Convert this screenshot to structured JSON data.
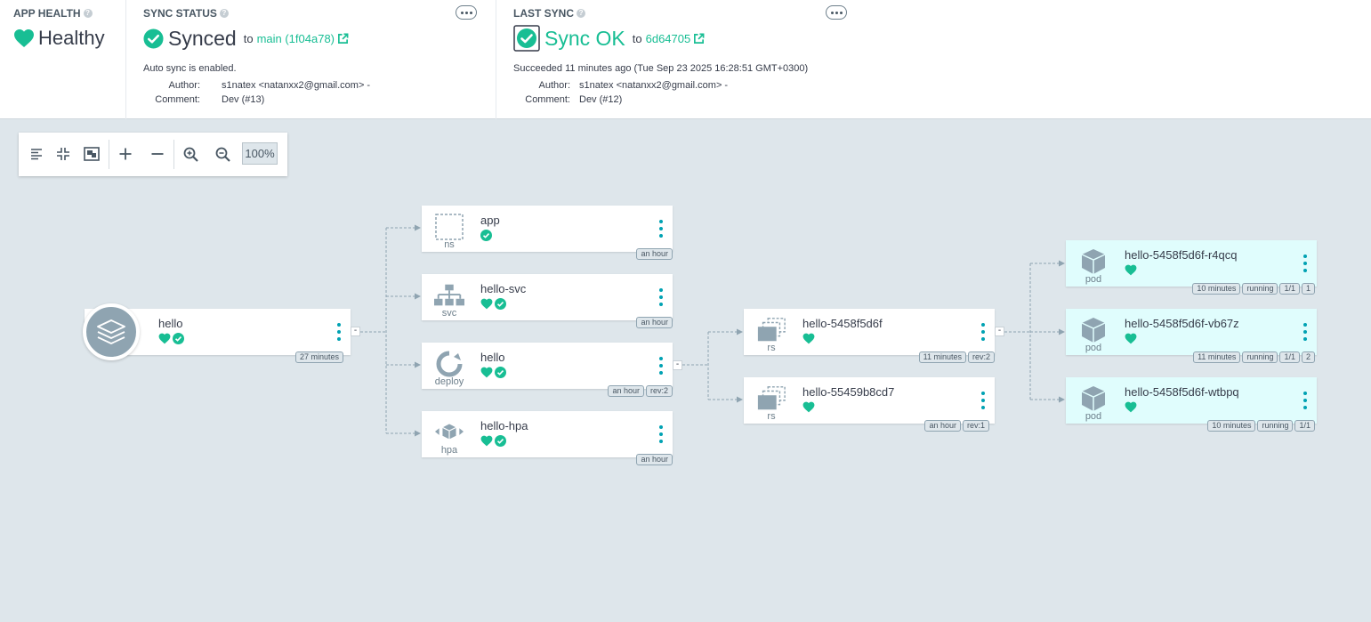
{
  "app_health": {
    "title": "APP HEALTH",
    "status": "Healthy",
    "color": "#18be94"
  },
  "sync_status": {
    "title": "SYNC STATUS",
    "status": "Synced",
    "to": "to",
    "revision": "main (1f04a78)",
    "auto_sync": "Auto sync is enabled.",
    "author_label": "Author:",
    "author": "s1natex <natanxx2@gmail.com> -",
    "comment_label": "Comment:",
    "comment": "Dev (#13)"
  },
  "last_sync": {
    "title": "LAST SYNC",
    "status": "Sync OK",
    "to": "to",
    "revision": "6d64705",
    "succeeded": "Succeeded 11 minutes ago (Tue Sep 23 2025 16:28:51 GMT+0300)",
    "author_label": "Author:",
    "author": "s1natex <natanxx2@gmail.com> -",
    "comment_label": "Comment:",
    "comment": "Dev (#12)"
  },
  "toolbar": {
    "zoom": "100%"
  },
  "graph": {
    "app": {
      "name": "hello",
      "tags": [
        "27 minutes"
      ],
      "collapse": "-"
    },
    "ns": {
      "kind": "ns",
      "name": "app",
      "tags": [
        "an hour"
      ]
    },
    "svc": {
      "kind": "svc",
      "name": "hello-svc",
      "tags": [
        "an hour"
      ]
    },
    "deploy": {
      "kind": "deploy",
      "name": "hello",
      "tags": [
        "an hour",
        "rev:2"
      ],
      "collapse": "-"
    },
    "hpa": {
      "kind": "hpa",
      "name": "hello-hpa",
      "tags": [
        "an hour"
      ]
    },
    "rs1": {
      "kind": "rs",
      "name": "hello-5458f5d6f",
      "tags": [
        "11 minutes",
        "rev:2"
      ],
      "collapse": "-"
    },
    "rs2": {
      "kind": "rs",
      "name": "hello-55459b8cd7",
      "tags": [
        "an hour",
        "rev:1"
      ]
    },
    "pod1": {
      "kind": "pod",
      "name": "hello-5458f5d6f-r4qcq",
      "tags": [
        "10 minutes",
        "running",
        "1/1",
        "1"
      ]
    },
    "pod2": {
      "kind": "pod",
      "name": "hello-5458f5d6f-vb67z",
      "tags": [
        "11 minutes",
        "running",
        "1/1",
        "2"
      ]
    },
    "pod3": {
      "kind": "pod",
      "name": "hello-5458f5d6f-wtbpq",
      "tags": [
        "10 minutes",
        "running",
        "1/1"
      ]
    }
  },
  "colors": {
    "healthy": "#18be94",
    "accent": "#00a2b3",
    "pod_bg": "#e0fdfd",
    "canvas": "#dee6eb"
  }
}
